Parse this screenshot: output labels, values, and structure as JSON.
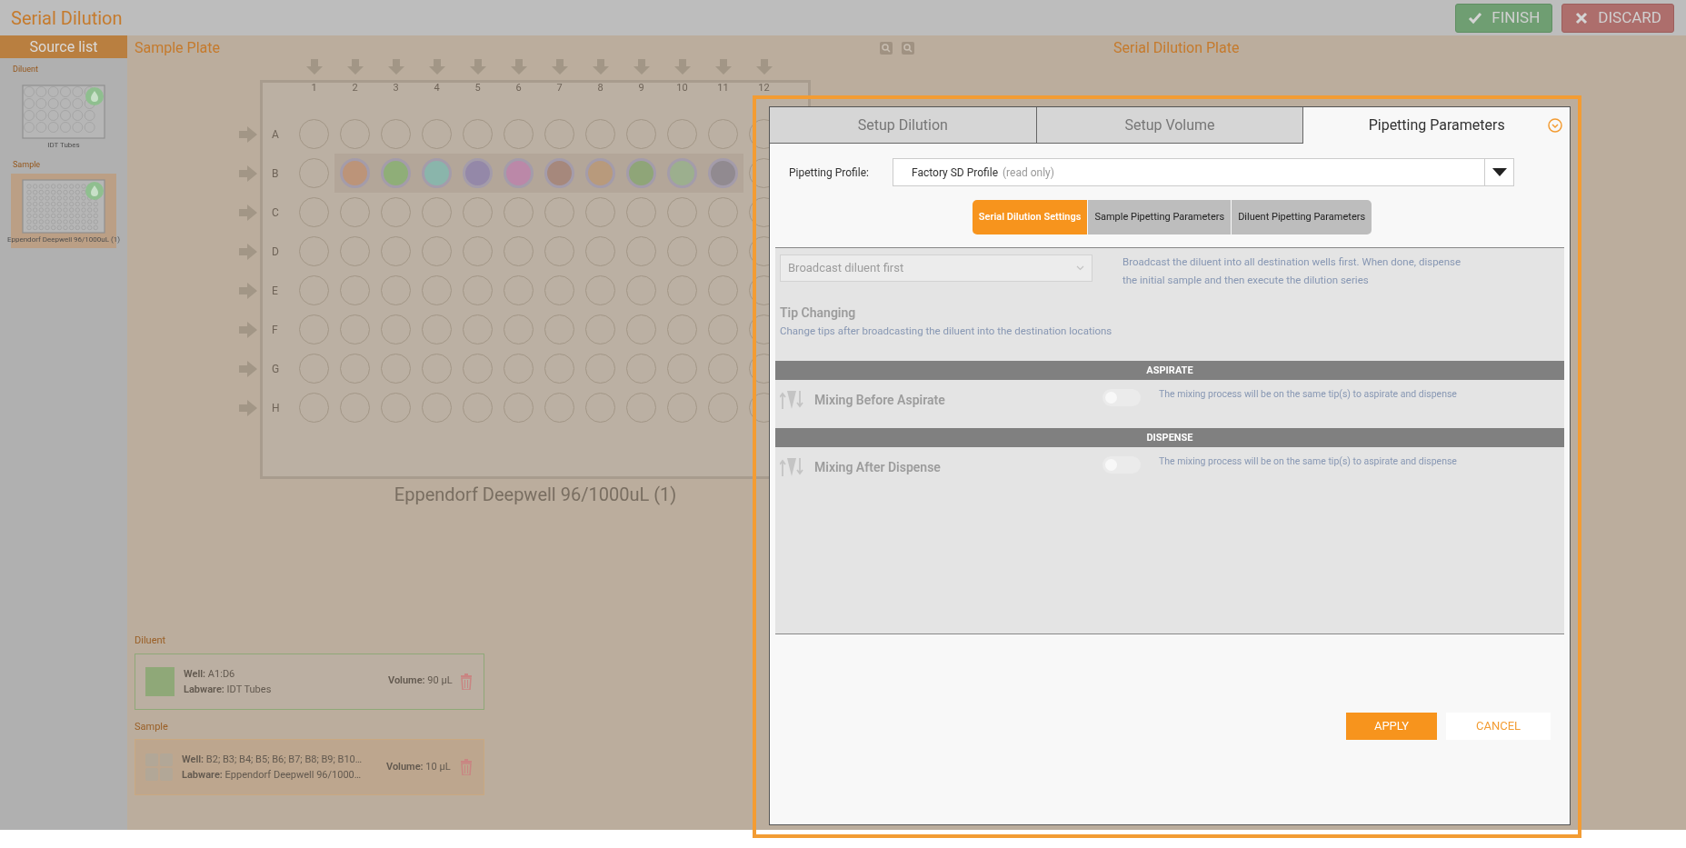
{
  "header": {
    "title": "Serial Dilution",
    "buttons": [
      {
        "label": "FINISH",
        "kind": "finish"
      },
      {
        "label": "DISCARD",
        "kind": "discard"
      }
    ]
  },
  "source_list": {
    "title": "Source list",
    "items": [
      {
        "label": "Diluent",
        "name": "IDT Tubes",
        "kind": "tubes",
        "selected": false
      },
      {
        "label": "Sample",
        "name": "Eppendorf Deepwell 96/1000uL (1)",
        "kind": "plate96",
        "selected": true
      }
    ]
  },
  "sample_plate": {
    "title": "Sample Plate",
    "name": "Eppendorf Deepwell 96/1000uL (1)",
    "columns": [
      "1",
      "2",
      "3",
      "4",
      "5",
      "6",
      "7",
      "8",
      "9",
      "10",
      "11",
      "12"
    ],
    "rows": [
      {
        "label": "A",
        "wells": [
          {
            "filled": false
          },
          {
            "filled": false
          },
          {
            "filled": false
          },
          {
            "filled": false
          },
          {
            "filled": false
          },
          {
            "filled": false
          },
          {
            "filled": false
          },
          {
            "filled": false
          },
          {
            "filled": false
          },
          {
            "filled": false
          },
          {
            "filled": false
          },
          {
            "filled": false
          }
        ]
      },
      {
        "label": "B",
        "wells": [
          {
            "filled": false
          },
          {
            "filled": true,
            "color": "#bc9479"
          },
          {
            "filled": true,
            "color": "#8fae78"
          },
          {
            "filled": true,
            "color": "#8ab5ab"
          },
          {
            "filled": true,
            "color": "#9488a8"
          },
          {
            "filled": true,
            "color": "#bb88a8"
          },
          {
            "filled": true,
            "color": "#a6887c"
          },
          {
            "filled": true,
            "color": "#b89a7c"
          },
          {
            "filled": true,
            "color": "#8fa578"
          },
          {
            "filled": true,
            "color": "#9caf8e"
          },
          {
            "filled": true,
            "color": "#918a90"
          },
          {
            "filled": false
          }
        ]
      },
      {
        "label": "C",
        "wells": [
          {
            "filled": false
          },
          {
            "filled": false
          },
          {
            "filled": false
          },
          {
            "filled": false
          },
          {
            "filled": false
          },
          {
            "filled": false
          },
          {
            "filled": false
          },
          {
            "filled": false
          },
          {
            "filled": false
          },
          {
            "filled": false
          },
          {
            "filled": false
          },
          {
            "filled": false
          }
        ]
      },
      {
        "label": "D",
        "wells": [
          {
            "filled": false
          },
          {
            "filled": false
          },
          {
            "filled": false
          },
          {
            "filled": false
          },
          {
            "filled": false
          },
          {
            "filled": false
          },
          {
            "filled": false
          },
          {
            "filled": false
          },
          {
            "filled": false
          },
          {
            "filled": false
          },
          {
            "filled": false
          },
          {
            "filled": false
          }
        ]
      },
      {
        "label": "E",
        "wells": [
          {
            "filled": false
          },
          {
            "filled": false
          },
          {
            "filled": false
          },
          {
            "filled": false
          },
          {
            "filled": false
          },
          {
            "filled": false
          },
          {
            "filled": false
          },
          {
            "filled": false
          },
          {
            "filled": false
          },
          {
            "filled": false
          },
          {
            "filled": false
          },
          {
            "filled": false
          }
        ]
      },
      {
        "label": "F",
        "wells": [
          {
            "filled": false
          },
          {
            "filled": false
          },
          {
            "filled": false
          },
          {
            "filled": false
          },
          {
            "filled": false
          },
          {
            "filled": false
          },
          {
            "filled": false
          },
          {
            "filled": false
          },
          {
            "filled": false
          },
          {
            "filled": false
          },
          {
            "filled": false
          },
          {
            "filled": false
          }
        ]
      },
      {
        "label": "G",
        "wells": [
          {
            "filled": false
          },
          {
            "filled": false
          },
          {
            "filled": false
          },
          {
            "filled": false
          },
          {
            "filled": false
          },
          {
            "filled": false
          },
          {
            "filled": false
          },
          {
            "filled": false
          },
          {
            "filled": false
          },
          {
            "filled": false
          },
          {
            "filled": false
          },
          {
            "filled": false
          }
        ]
      },
      {
        "label": "H",
        "wells": [
          {
            "filled": false
          },
          {
            "filled": false
          },
          {
            "filled": false
          },
          {
            "filled": false
          },
          {
            "filled": false
          },
          {
            "filled": false
          },
          {
            "filled": false
          },
          {
            "filled": false
          },
          {
            "filled": false
          },
          {
            "filled": false
          },
          {
            "filled": false
          },
          {
            "filled": false
          }
        ]
      }
    ]
  },
  "serial_dilution_plate": {
    "title": "Serial Dilution Plate"
  },
  "sources": [
    {
      "label": "Diluent",
      "kind": "solid",
      "color": "#8fa878",
      "well": "**Well:** A1:D6",
      "labware": "**Labware:** IDT Tubes",
      "volume": "**Volume:** 90 µL",
      "selected": false
    },
    {
      "label": "Sample",
      "kind": "grid",
      "well": "**Well:** B2; B3; B4; B5; B6; B7; B8; B9; B10…",
      "labware": "**Labware:** Eppendorf Deepwell 96/1000…",
      "volume": "**Volume:** 10 µL",
      "selected": true
    }
  ],
  "dialog": {
    "tabs": [
      {
        "label": "Setup Dilution",
        "selected": false
      },
      {
        "label": "Setup Volume",
        "selected": false
      },
      {
        "label": "Pipetting Parameters",
        "selected": true
      }
    ],
    "profile": {
      "label": "Pipetting Profile:",
      "value": "Factory SD Profile",
      "note": "(read only)"
    },
    "subtabs": [
      {
        "label": "Serial Dilution Settings",
        "selected": true
      },
      {
        "label": "Sample Pipetting Parameters",
        "selected": false
      },
      {
        "label": "Diluent Pipetting Parameters",
        "selected": false
      }
    ],
    "strategy": {
      "value": "Broadcast diluent first",
      "description": "Broadcast the diluent into all destination wells first. When done, dispense the initial sample and then execute the dilution series"
    },
    "tip_changing": {
      "title": "Tip Changing",
      "text": "Change tips after broadcasting the diluent into the destination locations"
    },
    "sections": [
      {
        "title": "ASPIRATE",
        "option": "Mixing Before Aspirate",
        "on": false,
        "description": "The mixing process will be on the same tip(s) to aspirate and dispense"
      },
      {
        "title": "DISPENSE",
        "option": "Mixing After Dispense",
        "on": false,
        "description": "The mixing process will be on the same tip(s) to aspirate and dispense"
      }
    ],
    "buttons": [
      {
        "label": "APPLY",
        "kind": "primary"
      },
      {
        "label": "CANCEL",
        "kind": "secondary"
      }
    ]
  }
}
